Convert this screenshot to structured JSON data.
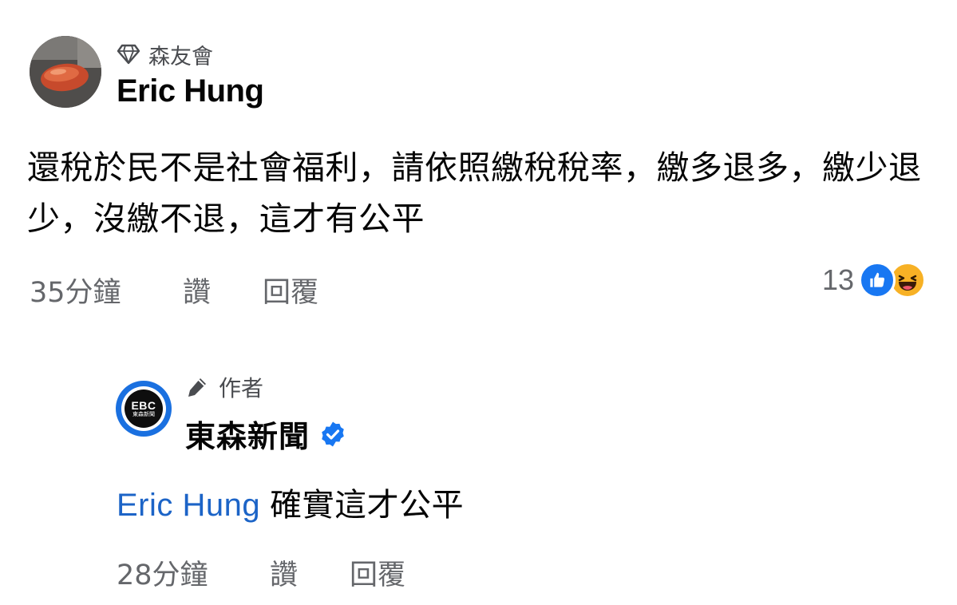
{
  "comment": {
    "badge_label": "森友會",
    "badge_icon": "diamond-icon",
    "author_name": "Eric Hung",
    "text": "還稅於民不是社會福利，請依照繳稅稅率，繳多退多，繳少退少，沒繳不退，這才有公平",
    "time": "35分鐘",
    "like_label": "讚",
    "reply_label": "回覆",
    "reaction_count": "13",
    "reactions": [
      "like-reaction-icon",
      "haha-reaction-icon"
    ]
  },
  "reply": {
    "badge_label": "作者",
    "badge_icon": "pencil-icon",
    "author_name": "東森新聞",
    "verified": true,
    "avatar_logo_text": "EBC",
    "avatar_logo_subtext": "東森新聞",
    "mention": "Eric Hung",
    "text": "確實這才公平",
    "time": "28分鐘",
    "like_label": "讚",
    "reply_label": "回覆"
  },
  "colors": {
    "mention": "#1c64c7",
    "secondary_text": "#65676b",
    "verified": "#1877f2",
    "like_reaction": "#1877f2",
    "haha_reaction": "#f7b125"
  }
}
